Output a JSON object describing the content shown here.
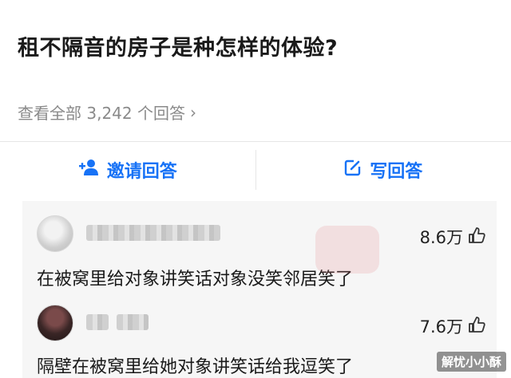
{
  "question": {
    "title": "租不隔音的房子是种怎样的体验?"
  },
  "answers_link": {
    "label": "查看全部 3,242 个回答"
  },
  "actions": {
    "invite_label": "邀请回答",
    "write_label": "写回答",
    "accent_color": "#1772f6"
  },
  "answers": [
    {
      "likes": "8.6万",
      "text": "在被窝里给对象讲笑话对象没笑邻居笑了"
    },
    {
      "likes": "7.6万",
      "text": "隔壁在被窝里给她对象讲笑话给我逗笑了"
    }
  ],
  "watermark": {
    "text": "解忧小小酥"
  }
}
